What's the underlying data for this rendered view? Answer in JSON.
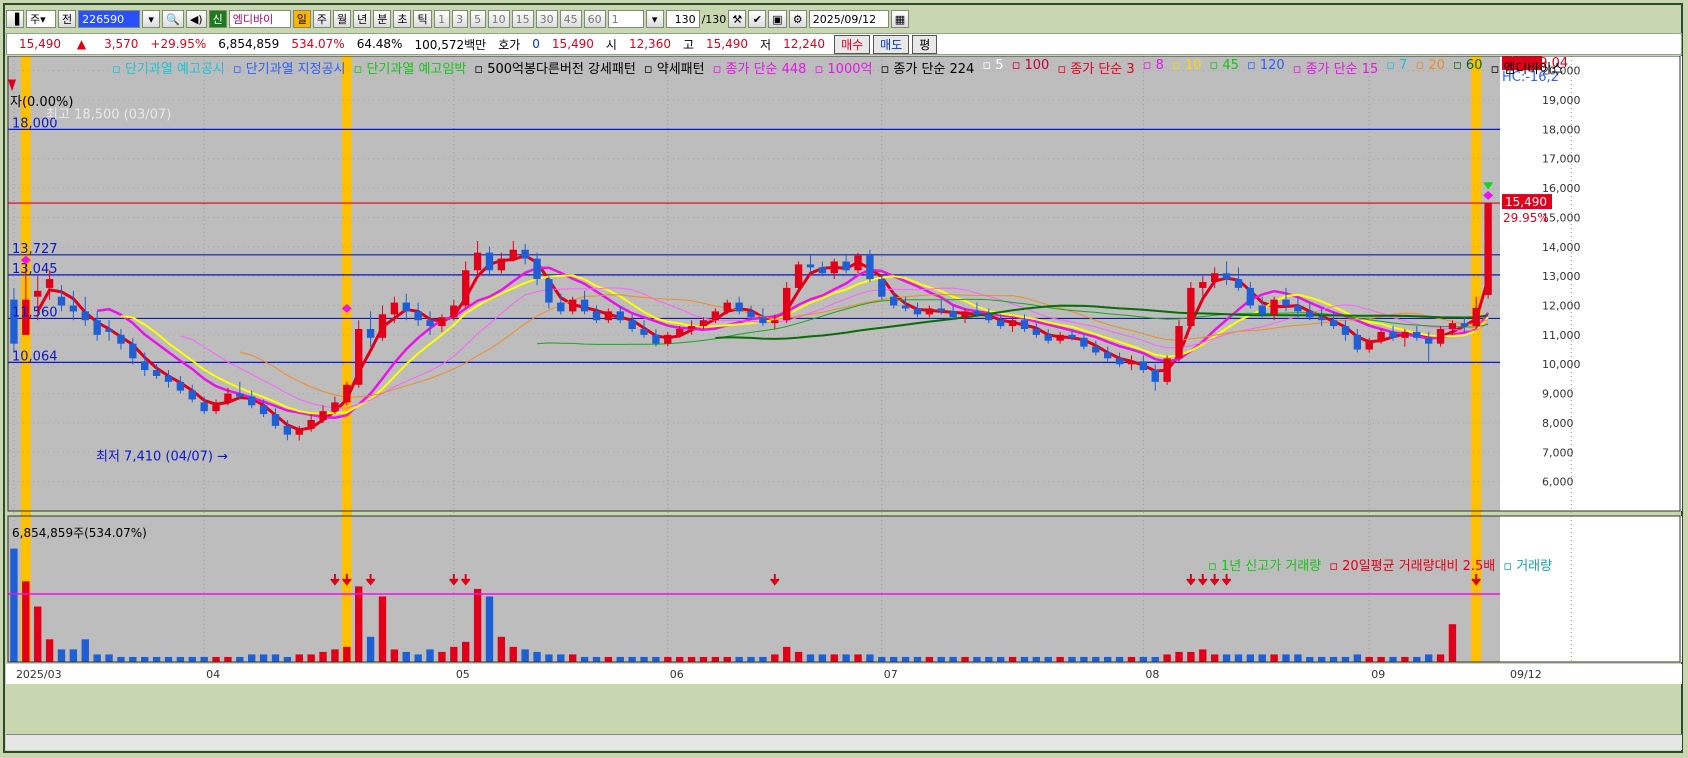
{
  "toolbar": {
    "period_label": "주",
    "prev_label": "전",
    "stock_code": "226590",
    "badge_label": "신",
    "stock_name": "엠디바이",
    "timeframes": [
      "일",
      "주",
      "월",
      "년",
      "분",
      "초",
      "틱"
    ],
    "active_timeframe": "일",
    "numbers": [
      "1",
      "3",
      "5",
      "10",
      "15",
      "30",
      "45",
      "60"
    ],
    "interval_value": "1",
    "count_value": "130",
    "count_total": "/130",
    "date_value": "2025/09/12"
  },
  "quote": {
    "price": "15,490",
    "change": "3,570",
    "change_pct": "+29.95%",
    "volume": "6,854,859",
    "volume_pct": "534.07%",
    "turnover_rate": "64.48%",
    "trade_value": "100,572백만",
    "hoga_label": "호가",
    "hoga_value": "0",
    "hoga_price": "15,490",
    "open_label": "시",
    "open": "12,360",
    "high_label": "고",
    "high": "15,490",
    "low_label": "저",
    "low": "12,240",
    "buy_label": "매수",
    "sell_label": "매도",
    "avg_label": "평"
  },
  "legend": [
    {
      "text": "단기과열 예고공시",
      "color": "#19c5d6"
    },
    {
      "text": "단기과열 지정공시",
      "color": "#2b60ff"
    },
    {
      "text": "단기과열 예고임박",
      "color": "#19c21b"
    },
    {
      "text": "500억봉다른버전 강세패턴",
      "color": "#000000"
    },
    {
      "text": "약세패턴",
      "color": "#000000"
    },
    {
      "text": "종가 단순 448",
      "color": "#e814e8"
    },
    {
      "text": "1000억",
      "color": "#e814e8"
    },
    {
      "text": "종가 단순 224",
      "color": "#000000"
    },
    {
      "text": "5",
      "color": "#ffffff"
    },
    {
      "text": "100",
      "color": "#c8003c"
    },
    {
      "text": "종가 단순 3",
      "color": "#e0001a"
    },
    {
      "text": "8",
      "color": "#e814e8"
    },
    {
      "text": "10",
      "color": "#ffd800"
    },
    {
      "text": "45",
      "color": "#19c21b"
    },
    {
      "text": "120",
      "color": "#2b60ff"
    },
    {
      "text": "종가 단순 15",
      "color": "#e814e8"
    },
    {
      "text": "7",
      "color": "#19c5d6"
    },
    {
      "text": "20",
      "color": "#f08c28"
    },
    {
      "text": "60",
      "color": "#0a6b0a"
    },
    {
      "text": "엠디바이스",
      "color": "#000000"
    }
  ],
  "price_labels": {
    "lc": "LC:109,04",
    "hc": "HC:-16,2",
    "zero_pct": "자(0.00%)",
    "high_note": "최고 18,500 (03/07)",
    "low_note": "최저 7,410 (04/07) →",
    "current": "15,490",
    "current_pct": "29.95%",
    "levels": [
      "18,000",
      "13,727",
      "13,045",
      "11,560",
      "10,064"
    ]
  },
  "volume_panel": {
    "volume_label": "6,854,859주(534.07%)",
    "legend": [
      {
        "text": "1년 신고가 거래량",
        "color": "#19c21b"
      },
      {
        "text": "20일평균 거래량대비 2.5배",
        "color": "#e0001a"
      },
      {
        "text": "거래량",
        "color": "#19a0a0"
      }
    ],
    "last": "6,855K",
    "last_pct": "534.07%"
  },
  "chart_data": {
    "type": "candlestick",
    "y_axis": {
      "min": 5000,
      "max": 20500,
      "ticks": [
        6000,
        7000,
        8000,
        9000,
        10000,
        11000,
        12000,
        13000,
        14000,
        15000,
        16000,
        17000,
        18000,
        19000,
        20000
      ]
    },
    "x_labels": [
      {
        "label": "2025/03",
        "index": 0
      },
      {
        "label": "04",
        "index": 16
      },
      {
        "label": "05",
        "index": 37
      },
      {
        "label": "06",
        "index": 55
      },
      {
        "label": "07",
        "index": 73
      },
      {
        "label": "08",
        "index": 95
      },
      {
        "label": "09",
        "index": 114
      },
      {
        "label": "09/12",
        "index": 131
      }
    ],
    "horizontal_levels": [
      {
        "value": 18000,
        "color": "#0a18c8"
      },
      {
        "value": 15490,
        "color": "#e0001a"
      },
      {
        "value": 13727,
        "color": "#0a18c8"
      },
      {
        "value": 13045,
        "color": "#0a18c8"
      },
      {
        "value": 11560,
        "color": "#0a18c8"
      },
      {
        "value": 10064,
        "color": "#0a18c8"
      }
    ],
    "highlight_indices": [
      1,
      28,
      123
    ],
    "volume_arrow_indices": [
      27,
      28,
      30,
      37,
      38,
      64,
      99,
      100,
      101,
      102,
      123
    ],
    "volume_threshold": 2.7,
    "candles": [
      [
        12200,
        12600,
        10400,
        10700
      ],
      [
        11000,
        13500,
        11000,
        12200
      ],
      [
        12300,
        13000,
        11500,
        12500
      ],
      [
        12600,
        13200,
        12200,
        12900
      ],
      [
        12300,
        12700,
        11800,
        12000
      ],
      [
        12000,
        12500,
        11500,
        11800
      ],
      [
        11800,
        12300,
        11300,
        11500
      ],
      [
        11500,
        11800,
        10800,
        11000
      ],
      [
        11200,
        11500,
        10800,
        11100
      ],
      [
        11000,
        11200,
        10500,
        10700
      ],
      [
        10700,
        10900,
        10000,
        10200
      ],
      [
        10100,
        10400,
        9600,
        9800
      ],
      [
        9800,
        10000,
        9500,
        9600
      ],
      [
        9600,
        9800,
        9200,
        9400
      ],
      [
        9400,
        9600,
        9000,
        9100
      ],
      [
        9100,
        9300,
        8700,
        8800
      ],
      [
        8700,
        8900,
        8300,
        8400
      ],
      [
        8400,
        8800,
        8300,
        8700
      ],
      [
        8700,
        9200,
        8600,
        9000
      ],
      [
        9000,
        9400,
        8800,
        8900
      ],
      [
        8900,
        9100,
        8500,
        8600
      ],
      [
        8600,
        8800,
        8200,
        8300
      ],
      [
        8300,
        8500,
        7800,
        7900
      ],
      [
        7900,
        8100,
        7410,
        7600
      ],
      [
        7600,
        7900,
        7400,
        7800
      ],
      [
        7800,
        8300,
        7700,
        8100
      ],
      [
        8100,
        8600,
        8000,
        8400
      ],
      [
        8400,
        8900,
        8300,
        8700
      ],
      [
        8700,
        9400,
        8600,
        9300
      ],
      [
        9300,
        11500,
        9200,
        11200
      ],
      [
        11200,
        11800,
        10600,
        10900
      ],
      [
        10900,
        12000,
        10800,
        11700
      ],
      [
        11700,
        12300,
        11400,
        12100
      ],
      [
        12100,
        12400,
        11500,
        11800
      ],
      [
        11800,
        12100,
        11300,
        11500
      ],
      [
        11500,
        11800,
        11000,
        11300
      ],
      [
        11300,
        11700,
        11100,
        11600
      ],
      [
        11600,
        12200,
        11500,
        12000
      ],
      [
        12000,
        13500,
        11900,
        13200
      ],
      [
        13200,
        14200,
        13000,
        13800
      ],
      [
        13800,
        14000,
        13000,
        13200
      ],
      [
        13200,
        13800,
        13100,
        13600
      ],
      [
        13600,
        14200,
        13500,
        13900
      ],
      [
        13900,
        14100,
        13400,
        13600
      ],
      [
        13600,
        13800,
        12700,
        12900
      ],
      [
        12900,
        13000,
        11900,
        12100
      ],
      [
        12100,
        12400,
        11700,
        11800
      ],
      [
        11800,
        12300,
        11700,
        12200
      ],
      [
        12200,
        12500,
        11700,
        11800
      ],
      [
        11800,
        12000,
        11400,
        11500
      ],
      [
        11500,
        11900,
        11400,
        11800
      ],
      [
        11800,
        12000,
        11400,
        11500
      ],
      [
        11500,
        11700,
        11100,
        11200
      ],
      [
        11200,
        11500,
        10900,
        11000
      ],
      [
        11000,
        11200,
        10600,
        10700
      ],
      [
        10700,
        11100,
        10600,
        11000
      ],
      [
        11000,
        11300,
        10900,
        11200
      ],
      [
        11200,
        11500,
        11000,
        11300
      ],
      [
        11300,
        11600,
        11200,
        11500
      ],
      [
        11500,
        11900,
        11400,
        11800
      ],
      [
        11800,
        12200,
        11700,
        12100
      ],
      [
        12100,
        12300,
        11700,
        11800
      ],
      [
        11800,
        12000,
        11500,
        11600
      ],
      [
        11600,
        11900,
        11300,
        11400
      ],
      [
        11400,
        11700,
        11200,
        11500
      ],
      [
        11500,
        12800,
        11400,
        12600
      ],
      [
        12600,
        13500,
        12500,
        13400
      ],
      [
        13400,
        13700,
        13100,
        13300
      ],
      [
        13300,
        13500,
        13000,
        13100
      ],
      [
        13100,
        13600,
        12900,
        13500
      ],
      [
        13500,
        13700,
        13100,
        13200
      ],
      [
        13200,
        13800,
        13100,
        13700
      ],
      [
        13700,
        13900,
        12800,
        12900
      ],
      [
        12900,
        13000,
        12200,
        12300
      ],
      [
        12300,
        12500,
        11900,
        12000
      ],
      [
        12000,
        12300,
        11800,
        11900
      ],
      [
        11900,
        12100,
        11600,
        11700
      ],
      [
        11700,
        12000,
        11600,
        11900
      ],
      [
        11900,
        12200,
        11700,
        11800
      ],
      [
        11800,
        12000,
        11500,
        11600
      ],
      [
        11600,
        11900,
        11400,
        11800
      ],
      [
        11800,
        12100,
        11600,
        11700
      ],
      [
        11700,
        11900,
        11400,
        11500
      ],
      [
        11500,
        11700,
        11200,
        11300
      ],
      [
        11300,
        11600,
        11100,
        11500
      ],
      [
        11500,
        11700,
        11100,
        11200
      ],
      [
        11200,
        11400,
        10900,
        11000
      ],
      [
        11000,
        11200,
        10700,
        10800
      ],
      [
        10800,
        11100,
        10700,
        11000
      ],
      [
        11000,
        11200,
        10800,
        10900
      ],
      [
        10900,
        11000,
        10500,
        10600
      ],
      [
        10600,
        10800,
        10300,
        10400
      ],
      [
        10400,
        10600,
        10100,
        10200
      ],
      [
        10200,
        10400,
        9900,
        10000
      ],
      [
        10000,
        10300,
        9800,
        10100
      ],
      [
        10100,
        10300,
        9700,
        9800
      ],
      [
        9800,
        10000,
        9100,
        9400
      ],
      [
        9400,
        10300,
        9300,
        10200
      ],
      [
        10200,
        11500,
        10100,
        11300
      ],
      [
        11300,
        12800,
        11200,
        12600
      ],
      [
        12600,
        13000,
        12300,
        12800
      ],
      [
        12800,
        13300,
        12600,
        13100
      ],
      [
        13100,
        13500,
        12700,
        12900
      ],
      [
        12900,
        13300,
        12500,
        12600
      ],
      [
        12600,
        12800,
        11900,
        12000
      ],
      [
        12000,
        12300,
        11600,
        11700
      ],
      [
        11700,
        12300,
        11500,
        12200
      ],
      [
        12200,
        12600,
        11800,
        12000
      ],
      [
        12000,
        12300,
        11600,
        11800
      ],
      [
        11800,
        12100,
        11500,
        11600
      ],
      [
        11600,
        11900,
        11300,
        11500
      ],
      [
        11500,
        11800,
        11200,
        11300
      ],
      [
        11300,
        11500,
        10800,
        11000
      ],
      [
        11000,
        11200,
        10400,
        10500
      ],
      [
        10500,
        10900,
        10400,
        10800
      ],
      [
        10800,
        11200,
        10700,
        11100
      ],
      [
        11100,
        11300,
        10800,
        10900
      ],
      [
        10900,
        11200,
        10600,
        11100
      ],
      [
        11100,
        11300,
        10800,
        10900
      ],
      [
        10900,
        11100,
        10100,
        10700
      ],
      [
        10700,
        11300,
        10600,
        11200
      ],
      [
        11200,
        11500,
        11000,
        11400
      ],
      [
        11400,
        11600,
        11100,
        11300
      ],
      [
        11300,
        12300,
        11200,
        11920
      ],
      [
        12360,
        15490,
        12240,
        15490
      ]
    ],
    "volume": [
      4.5,
      3.2,
      2.2,
      0.9,
      0.5,
      0.5,
      0.9,
      0.3,
      0.3,
      0.2,
      0.2,
      0.2,
      0.2,
      0.2,
      0.2,
      0.2,
      0.2,
      0.2,
      0.2,
      0.2,
      0.3,
      0.3,
      0.3,
      0.2,
      0.3,
      0.3,
      0.4,
      0.5,
      0.6,
      3.0,
      1.0,
      2.6,
      0.5,
      0.4,
      0.3,
      0.5,
      0.4,
      0.6,
      0.8,
      2.9,
      2.6,
      1.0,
      0.6,
      0.5,
      0.4,
      0.3,
      0.3,
      0.3,
      0.2,
      0.2,
      0.2,
      0.2,
      0.2,
      0.2,
      0.2,
      0.2,
      0.2,
      0.2,
      0.2,
      0.2,
      0.2,
      0.2,
      0.2,
      0.2,
      0.3,
      0.6,
      0.4,
      0.3,
      0.3,
      0.3,
      0.3,
      0.3,
      0.3,
      0.2,
      0.2,
      0.2,
      0.2,
      0.2,
      0.2,
      0.2,
      0.2,
      0.2,
      0.2,
      0.2,
      0.2,
      0.2,
      0.2,
      0.2,
      0.2,
      0.2,
      0.2,
      0.2,
      0.2,
      0.2,
      0.2,
      0.2,
      0.2,
      0.3,
      0.4,
      0.4,
      0.5,
      0.3,
      0.3,
      0.3,
      0.3,
      0.3,
      0.3,
      0.3,
      0.3,
      0.2,
      0.2,
      0.2,
      0.2,
      0.3,
      0.2,
      0.2,
      0.2,
      0.2,
      0.2,
      0.3,
      0.3,
      1.5
    ]
  }
}
